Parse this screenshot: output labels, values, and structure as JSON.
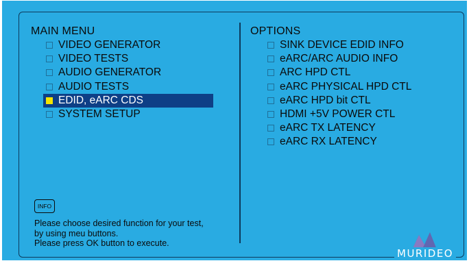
{
  "main_menu": {
    "title": "MAIN MENU",
    "items": [
      {
        "label": "VIDEO GENERATOR",
        "selected": false
      },
      {
        "label": "VIDEO TESTS",
        "selected": false
      },
      {
        "label": "AUDIO GENERATOR",
        "selected": false
      },
      {
        "label": "AUDIO TESTS",
        "selected": false
      },
      {
        "label": "EDID, eARC CDS",
        "selected": true
      },
      {
        "label": "SYSTEM SETUP",
        "selected": false
      }
    ]
  },
  "options": {
    "title": "OPTIONS",
    "items": [
      {
        "label": "SINK DEVICE EDID INFO"
      },
      {
        "label": "eARC/ARC AUDIO INFO"
      },
      {
        "label": "ARC HPD CTL"
      },
      {
        "label": "eARC PHYSICAL HPD CTL"
      },
      {
        "label": "eARC HPD bit CTL"
      },
      {
        "label": "HDMI +5V POWER CTL"
      },
      {
        "label": "eARC TX LATENCY"
      },
      {
        "label": "eARC RX LATENCY"
      }
    ]
  },
  "info_button": {
    "label": "INFO"
  },
  "help_text": {
    "line1": "Please choose desired function for your test,",
    "line2": "by using meu buttons.",
    "line3": "Please press OK button to execute."
  },
  "brand": {
    "name": "MURIDEO",
    "logo_icon": "murideo-mountain-logo"
  },
  "colors": {
    "background": "#29abe2",
    "selection": "#0e3f86",
    "selected_checkbox": "#f5e400",
    "border": "#0d3a5c"
  }
}
